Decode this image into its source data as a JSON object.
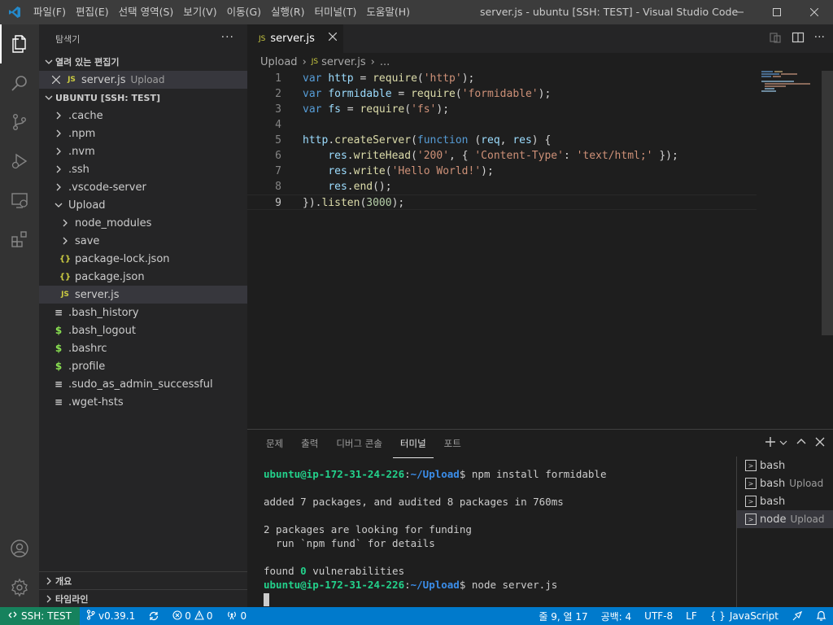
{
  "window": {
    "menus": [
      "파일(F)",
      "편집(E)",
      "선택 영역(S)",
      "보기(V)",
      "이동(G)",
      "실행(R)",
      "터미널(T)",
      "도움말(H)"
    ],
    "title": "server.js - ubuntu [SSH: TEST] - Visual Studio Code"
  },
  "activity_bar": [
    "files-icon",
    "search-icon",
    "source-control-icon",
    "run-debug-icon",
    "remote-explorer-icon",
    "extensions-icon",
    "account-icon",
    "settings-gear-icon"
  ],
  "sidebar": {
    "title": "탐색기",
    "open_editors": {
      "label": "열려 있는 편집기",
      "items": [
        {
          "name": "server.js",
          "desc": "Upload"
        }
      ]
    },
    "workspace": {
      "label": "UBUNTU [SSH: TEST]",
      "items": [
        {
          "name": ".cache",
          "kind": "folder"
        },
        {
          "name": ".npm",
          "kind": "folder"
        },
        {
          "name": ".nvm",
          "kind": "folder"
        },
        {
          "name": ".ssh",
          "kind": "folder"
        },
        {
          "name": ".vscode-server",
          "kind": "folder"
        },
        {
          "name": "Upload",
          "kind": "folder-open"
        },
        {
          "name": "node_modules",
          "kind": "folder"
        },
        {
          "name": "save",
          "kind": "folder"
        },
        {
          "name": "package-lock.json",
          "kind": "json"
        },
        {
          "name": "package.json",
          "kind": "json"
        },
        {
          "name": "server.js",
          "kind": "js"
        },
        {
          "name": ".bash_history",
          "kind": "text"
        },
        {
          "name": ".bash_logout",
          "kind": "shell"
        },
        {
          "name": ".bashrc",
          "kind": "shell"
        },
        {
          "name": ".profile",
          "kind": "shell"
        },
        {
          "name": ".sudo_as_admin_successful",
          "kind": "text"
        },
        {
          "name": ".wget-hsts",
          "kind": "text"
        }
      ]
    },
    "outline_label": "개요",
    "timeline_label": "타임라인"
  },
  "editor": {
    "tab_label": "server.js",
    "breadcrumb": [
      "Upload",
      "server.js",
      "..."
    ],
    "lines": [
      "var http = require('http');",
      "var formidable = require('formidable');",
      "var fs = require('fs');",
      "",
      "http.createServer(function (req, res) {",
      "    res.writeHead('200', { 'Content-Type': 'text/html;' });",
      "    res.write('Hello World!');",
      "    res.end();",
      "}).listen(3000);"
    ],
    "line_numbers": [
      "1",
      "2",
      "3",
      "4",
      "5",
      "6",
      "7",
      "8",
      "9"
    ]
  },
  "panel": {
    "tabs": [
      "문제",
      "출력",
      "디버그 콘솔",
      "터미널",
      "포트"
    ],
    "active_tab": "터미널",
    "terminal": {
      "prompt_user": "ubuntu@ip-172-31-24-226",
      "prompt_sep": ":",
      "prompt_path": "~/Upload",
      "prompt_dollar": "$",
      "cmd1": " npm install formidable",
      "out1": "added 7 packages, and audited 8 packages in 760ms",
      "out2": "2 packages are looking for funding",
      "out3": "  run `npm fund` for details",
      "out4_pre": "found ",
      "out4_num": "0",
      "out4_post": " vulnerabilities",
      "cmd2": " node server.js"
    },
    "terminals": [
      {
        "name": "bash",
        "desc": ""
      },
      {
        "name": "bash",
        "desc": "Upload"
      },
      {
        "name": "bash",
        "desc": ""
      },
      {
        "name": "node",
        "desc": "Upload"
      }
    ]
  },
  "status": {
    "remote": "SSH: TEST",
    "branch": "v0.39.1",
    "errors": "0",
    "warnings": "0",
    "ports": "0",
    "position": "줄 9, 열 17",
    "spaces": "공백: 4",
    "encoding": "UTF-8",
    "eol": "LF",
    "language": "JavaScript"
  },
  "colors": {
    "accent": "#007acc",
    "remote": "#16825d",
    "activity_bar": "#333333",
    "sidebar": "#252526",
    "editor": "#1e1e1e"
  }
}
